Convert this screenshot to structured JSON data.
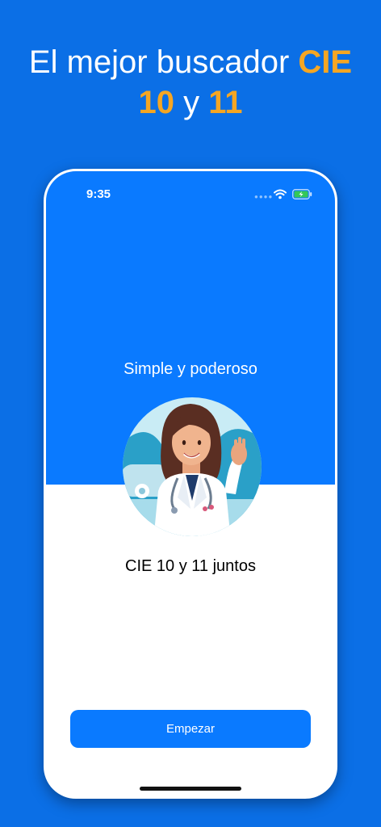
{
  "headline": {
    "line1_prefix": "El mejor buscador ",
    "line1_highlight": "CIE",
    "line2_num1": "10",
    "line2_mid": " y ",
    "line2_num2": "11"
  },
  "status_bar": {
    "time": "9:35",
    "icons": [
      "signal-dots-icon",
      "wifi-icon",
      "battery-charging-icon"
    ]
  },
  "onboarding": {
    "subtitle": "Simple y poderoso",
    "caption": "CIE 10 y 11 juntos",
    "illustration": "doctor-waving-illustration",
    "button_label": "Empezar"
  },
  "colors": {
    "background": "#0B6FE6",
    "highlight": "#F5A623",
    "primary": "#0A7AFF"
  }
}
